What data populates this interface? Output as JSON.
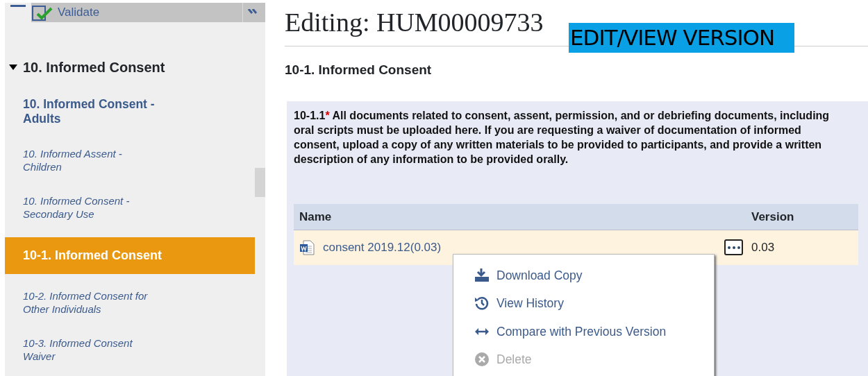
{
  "toolbar": {
    "validate_label": "Validate"
  },
  "sidebar": {
    "section": {
      "label": "10. Informed Consent",
      "expanded": true
    },
    "items": [
      {
        "label": "10. Informed Consent - Adults",
        "kind": "primary",
        "selected": false
      },
      {
        "label": "10. Informed Assent - Children",
        "kind": "secondary",
        "selected": false
      },
      {
        "label": "10. Informed Consent - Secondary Use",
        "kind": "secondary",
        "selected": false
      },
      {
        "label": "10-1. Informed Consent",
        "kind": "secondary",
        "selected": true
      },
      {
        "label": "10-2. Informed Consent for Other Individuals",
        "kind": "secondary",
        "selected": false
      },
      {
        "label": "10-3. Informed Consent Waiver",
        "kind": "secondary",
        "selected": false
      }
    ]
  },
  "page": {
    "title": "Editing: HUM00009733",
    "annotation": "EDIT/VIEW VERSION",
    "section_title": "10-1. Informed Consent"
  },
  "question": {
    "number": "10-1.1",
    "required_mark": "*",
    "text": "All documents related to consent, assent, permission, and or debriefing documents, including oral scripts must be uploaded here. If you are requesting a waiver of documentation of informed consent, upload a copy of any written materials to be provided to participants, and provide a written description of any information to be provided orally."
  },
  "table": {
    "columns": [
      "Name",
      "Version"
    ],
    "rows": [
      {
        "name": "consent 2019.12(0.03)",
        "version": "0.03",
        "menu_open": true
      }
    ]
  },
  "menu": {
    "items": [
      {
        "label": "Download Copy",
        "kind": "download",
        "disabled": false
      },
      {
        "label": "View History",
        "kind": "history",
        "disabled": false
      },
      {
        "label": "Compare with Previous Version",
        "kind": "compare",
        "disabled": false
      },
      {
        "label": "Delete",
        "kind": "delete",
        "disabled": true
      }
    ]
  }
}
